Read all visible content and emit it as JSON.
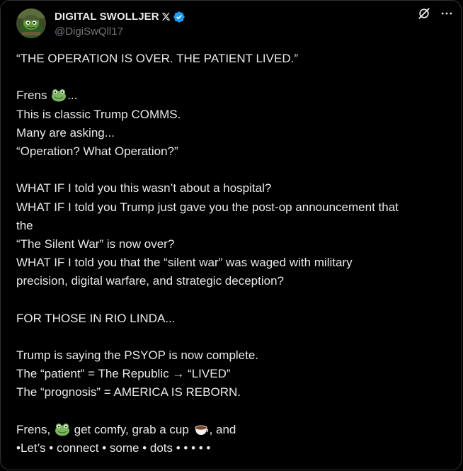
{
  "post": {
    "author": {
      "display_name": "DIGITAL SWOLLJER",
      "handle": "@DigiSwQll17",
      "verified": true,
      "avatar_icon": "frog-soldier-avatar"
    },
    "actions": {
      "grok_icon": "grok-icon",
      "more_icon": "more-icon"
    },
    "lines": {
      "l1": "“THE OPERATION IS OVER. THE PATIENT LIVED.”",
      "l2_pre": "Frens ",
      "l2_post": "...",
      "l3": "This is classic Trump COMMS.",
      "l4": "Many are asking...",
      "l5": "“Operation? What Operation?”",
      "l6": "WHAT IF I told you this wasn’t about a hospital?",
      "l7": "WHAT IF I told you Trump just gave you the post-op announcement that",
      "l8": "the",
      "l9": "“The Silent War” is now over?",
      "l10": "WHAT IF I told you that the “silent war” was waged with military",
      "l11": "precision, digital warfare, and strategic deception?",
      "l12": "FOR THOSE IN RIO LINDA...",
      "l13": "Trump is saying the PSYOP is now complete.",
      "l14": "The “patient” = The Republic → “LIVED”",
      "l15": "The “prognosis” = AMERICA IS REBORN.",
      "l16_a": "Frens, ",
      "l16_b": " get comfy, grab a cup ",
      "l16_c": ", and",
      "l17": "•Let’s • connect • some • dots • • • • •"
    },
    "colors": {
      "background": "#000000",
      "text": "#e7e9ea",
      "secondary": "#71767b",
      "verified": "#1d9bf0",
      "border": "#2f3336"
    }
  }
}
